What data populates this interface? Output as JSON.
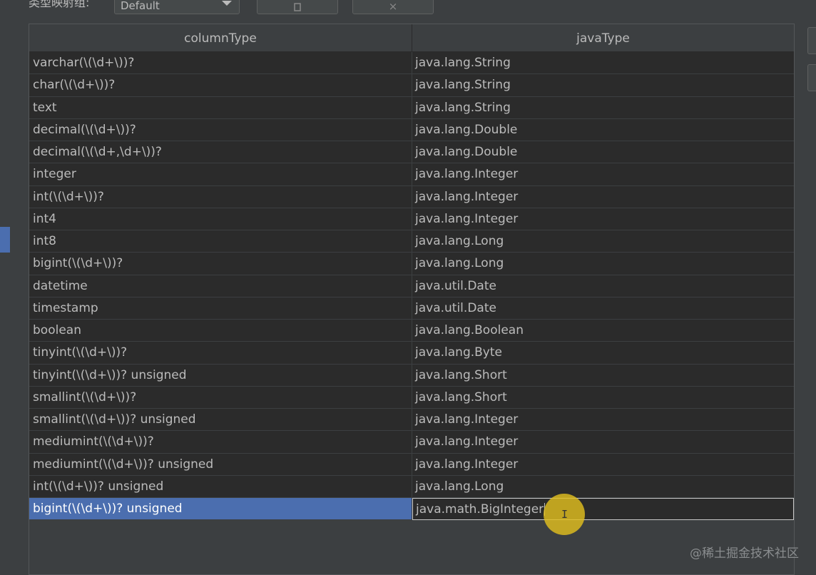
{
  "toolbar": {
    "group_label": "类型映射组:",
    "combo_value": "Default",
    "copy_icon": "copy-icon",
    "delete_icon": "close-icon",
    "delete_glyph": "×"
  },
  "table": {
    "headers": [
      "columnType",
      "javaType"
    ],
    "rows": [
      {
        "columnType": "varchar(\\(\\d+\\))?",
        "javaType": "java.lang.String"
      },
      {
        "columnType": "char(\\(\\d+\\))?",
        "javaType": "java.lang.String"
      },
      {
        "columnType": "text",
        "javaType": "java.lang.String"
      },
      {
        "columnType": "decimal(\\(\\d+\\))?",
        "javaType": "java.lang.Double"
      },
      {
        "columnType": "decimal(\\(\\d+,\\d+\\))?",
        "javaType": "java.lang.Double"
      },
      {
        "columnType": "integer",
        "javaType": "java.lang.Integer"
      },
      {
        "columnType": "int(\\(\\d+\\))?",
        "javaType": "java.lang.Integer"
      },
      {
        "columnType": "int4",
        "javaType": "java.lang.Integer"
      },
      {
        "columnType": "int8",
        "javaType": "java.lang.Long"
      },
      {
        "columnType": "bigint(\\(\\d+\\))?",
        "javaType": "java.lang.Long"
      },
      {
        "columnType": "datetime",
        "javaType": "java.util.Date"
      },
      {
        "columnType": "timestamp",
        "javaType": "java.util.Date"
      },
      {
        "columnType": "boolean",
        "javaType": "java.lang.Boolean"
      },
      {
        "columnType": "tinyint(\\(\\d+\\))?",
        "javaType": "java.lang.Byte"
      },
      {
        "columnType": "tinyint(\\(\\d+\\))? unsigned",
        "javaType": "java.lang.Short"
      },
      {
        "columnType": "smallint(\\(\\d+\\))?",
        "javaType": "java.lang.Short"
      },
      {
        "columnType": "smallint(\\(\\d+\\))? unsigned",
        "javaType": "java.lang.Integer"
      },
      {
        "columnType": "mediumint(\\(\\d+\\))?",
        "javaType": "java.lang.Integer"
      },
      {
        "columnType": "mediumint(\\(\\d+\\))? unsigned",
        "javaType": "java.lang.Integer"
      },
      {
        "columnType": "int(\\(\\d+\\))? unsigned",
        "javaType": "java.lang.Long"
      },
      {
        "columnType": "bigint(\\(\\d+\\))? unsigned",
        "javaType": "java.math.BigInteger",
        "selected": true,
        "editing": true
      }
    ]
  },
  "watermark": "@稀土掘金技术社区",
  "colors": {
    "background": "#3c3f41",
    "cell": "#2b2b2b",
    "selection": "#4b6eaf",
    "cursor_highlight": "#e1be1e"
  }
}
